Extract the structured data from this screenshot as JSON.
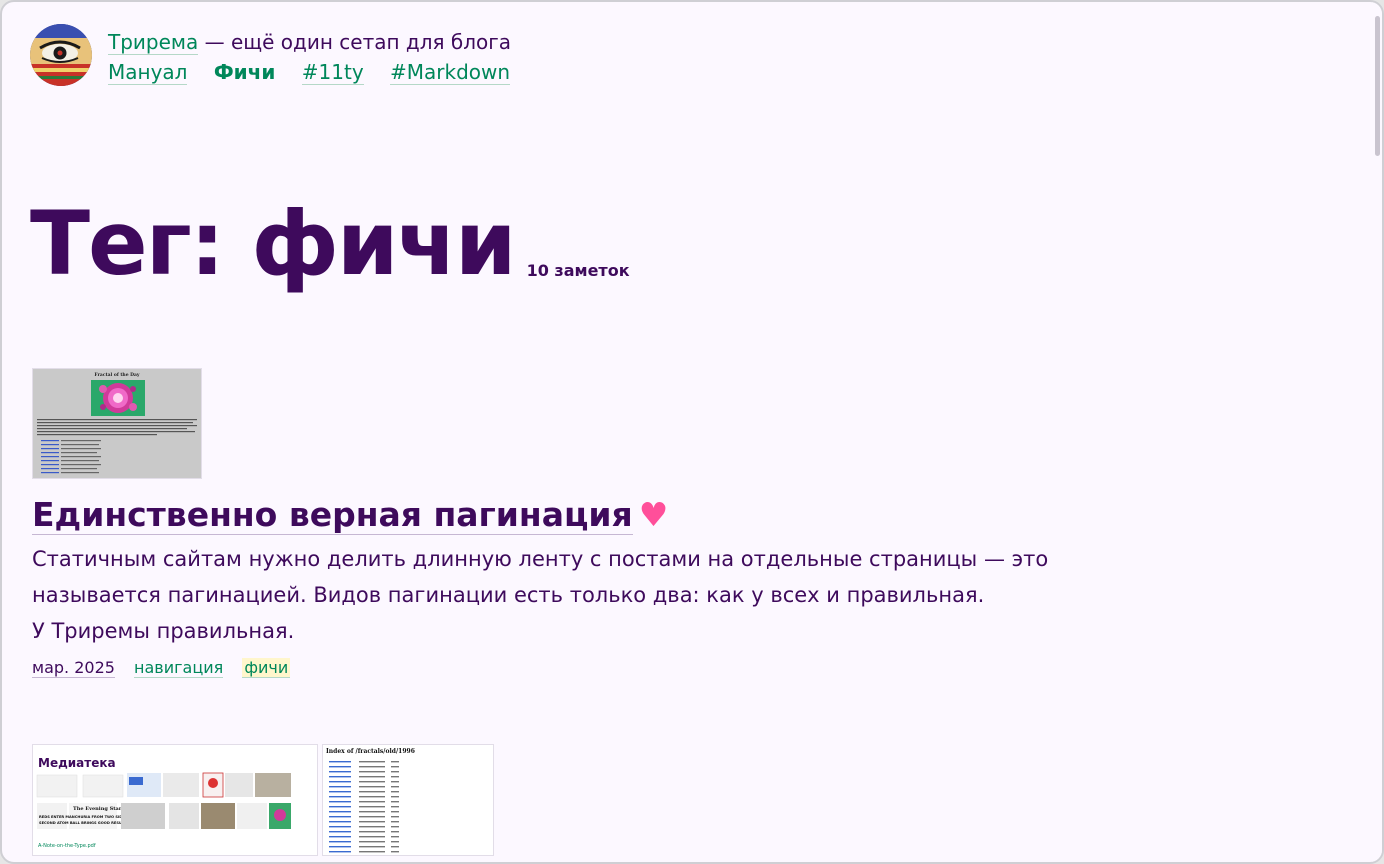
{
  "header": {
    "site_name": "Трирема",
    "tagline_rest": " — ещё один сетап для блога",
    "nav": [
      {
        "label": "Мануал"
      },
      {
        "label": "Фичи"
      },
      {
        "label": "#11ty"
      },
      {
        "label": "#Markdown"
      }
    ]
  },
  "page": {
    "title": "Тег: фичи",
    "count": "10 заметок"
  },
  "posts": [
    {
      "title": "Единственно верная пагинация",
      "heart": "♥",
      "excerpt_lines": [
        "Статичным сайтам нужно делить длинную ленту с постами на отдельные страницы — это",
        "называется пагинацией. Видов пагинации есть только два: как у всех и правильная.",
        "У Триремы правильная."
      ],
      "date": "мар. 2025",
      "tags": [
        "навигация",
        "фичи"
      ],
      "thumb": {
        "heading": "Fractal of the Day"
      }
    },
    {
      "thumbs": [
        {
          "heading": "Медиатека",
          "newspaper": "The Evening Star",
          "headline_1": "REDS ENTER MANCHURIA FROM TWO SIDES",
          "headline_2": "SECOND ATOM BALL BRINGS GOOD RESULTS",
          "caption": "A-Note-on-the-Type.pdf"
        },
        {
          "heading": "Index of /fractals/old/1996"
        }
      ]
    }
  ]
}
